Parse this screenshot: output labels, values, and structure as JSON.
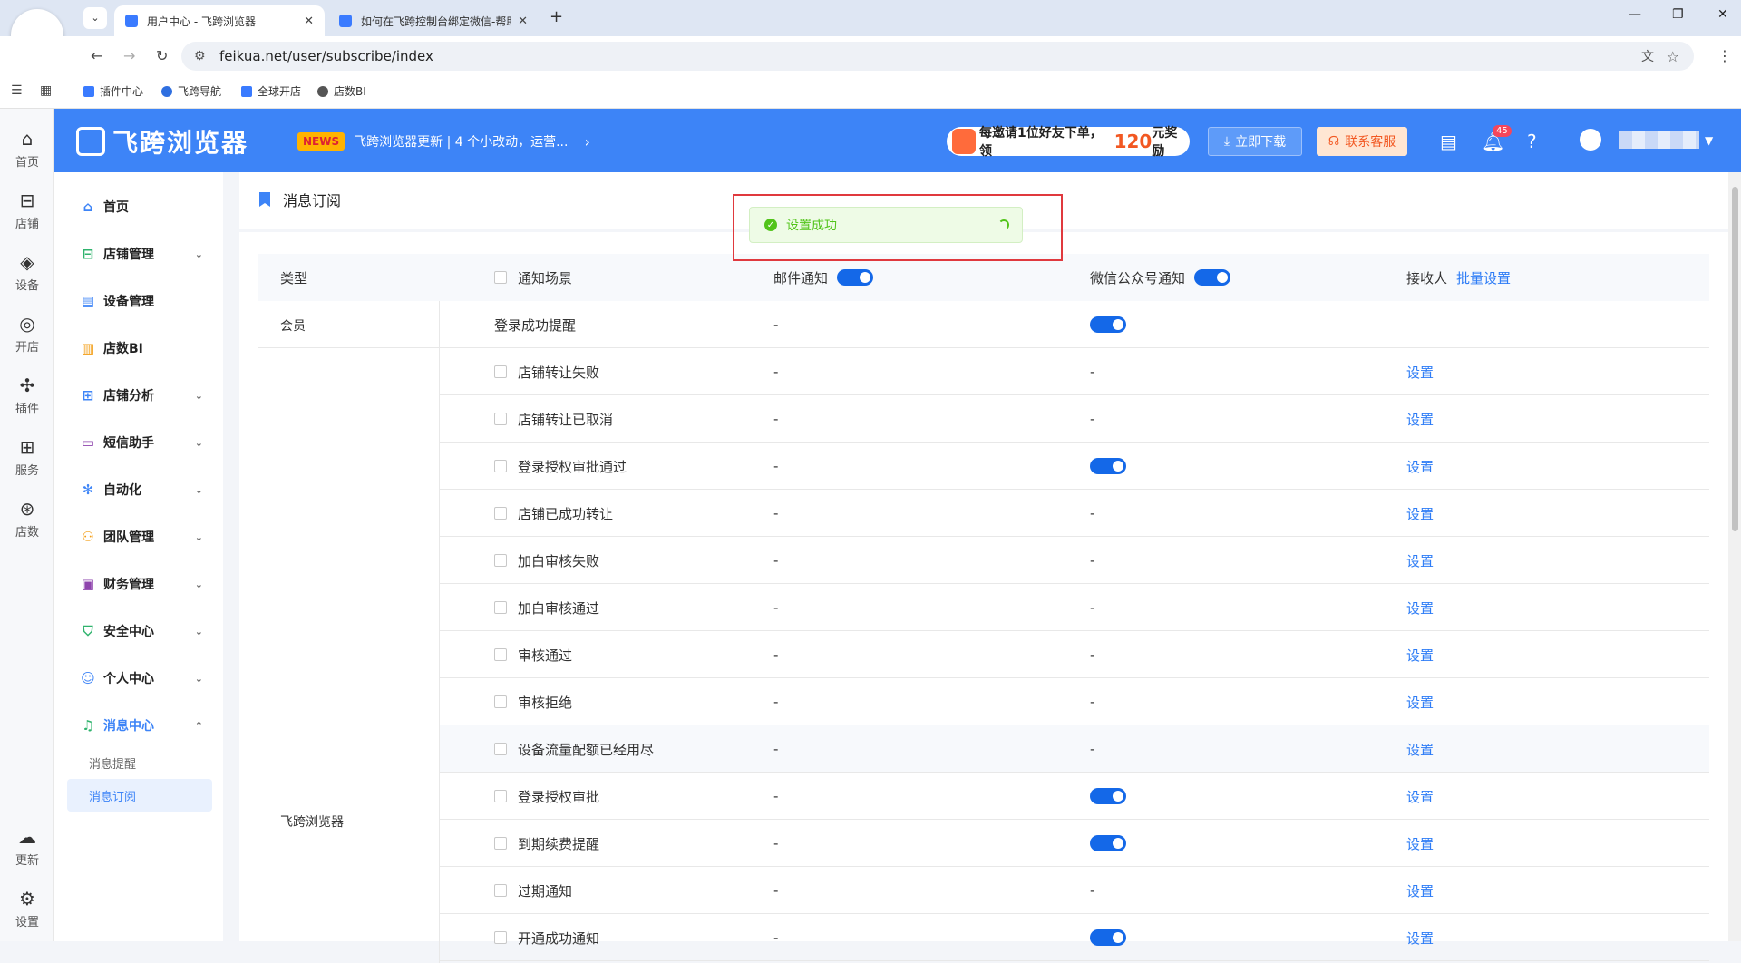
{
  "browser": {
    "tabs": [
      {
        "title": "用户中心 - 飞跨浏览器"
      },
      {
        "title": "如何在飞跨控制台绑定微信-帮助"
      }
    ],
    "url": "feikua.net/user/subscribe/index",
    "bookmarks": [
      "插件中心",
      "飞跨导航",
      "全球开店",
      "店数BI"
    ]
  },
  "rail": {
    "items": [
      "首页",
      "店铺",
      "设备",
      "开店",
      "插件",
      "服务",
      "店数"
    ],
    "bottom": [
      "更新",
      "设置"
    ]
  },
  "header": {
    "brand": "飞跨浏览器",
    "news_badge": "NEWS",
    "news_text": "飞跨浏览器更新 | 4 个小改动，运营...",
    "invite_pre": "每邀请1位好友下单，领",
    "invite_amount": "120",
    "invite_post": "元奖励",
    "download": "立即下载",
    "support": "联系客服",
    "notif_count": "45"
  },
  "sidenav": {
    "items": [
      "首页",
      "店铺管理",
      "设备管理",
      "店数BI",
      "店铺分析",
      "短信助手",
      "自动化",
      "团队管理",
      "财务管理",
      "安全中心",
      "个人中心",
      "消息中心"
    ],
    "sub": [
      "消息提醒",
      "消息订阅"
    ]
  },
  "page": {
    "title": "消息订阅"
  },
  "toast": {
    "text": "设置成功"
  },
  "table": {
    "headers": {
      "type": "类型",
      "scene": "通知场景",
      "email": "邮件通知",
      "wechat": "微信公众号通知",
      "receiver": "接收人",
      "batch": "批量设置"
    },
    "groups": [
      "会员",
      "飞跨浏览器"
    ],
    "rows": [
      {
        "scene": "登录成功提醒",
        "email": "-",
        "wechat_on": true,
        "wechat": "",
        "action": "",
        "checkbox": false
      },
      {
        "scene": "店铺转让失败",
        "email": "-",
        "wechat_on": false,
        "wechat": "-",
        "action": "设置",
        "checkbox": true
      },
      {
        "scene": "店铺转让已取消",
        "email": "-",
        "wechat_on": false,
        "wechat": "-",
        "action": "设置",
        "checkbox": true
      },
      {
        "scene": "登录授权审批通过",
        "email": "-",
        "wechat_on": true,
        "wechat": "",
        "action": "设置",
        "checkbox": true
      },
      {
        "scene": "店铺已成功转让",
        "email": "-",
        "wechat_on": false,
        "wechat": "-",
        "action": "设置",
        "checkbox": true
      },
      {
        "scene": "加白审核失败",
        "email": "-",
        "wechat_on": false,
        "wechat": "-",
        "action": "设置",
        "checkbox": true
      },
      {
        "scene": "加白审核通过",
        "email": "-",
        "wechat_on": false,
        "wechat": "-",
        "action": "设置",
        "checkbox": true
      },
      {
        "scene": "审核通过",
        "email": "-",
        "wechat_on": false,
        "wechat": "-",
        "action": "设置",
        "checkbox": true
      },
      {
        "scene": "审核拒绝",
        "email": "-",
        "wechat_on": false,
        "wechat": "-",
        "action": "设置",
        "checkbox": true
      },
      {
        "scene": "设备流量配额已经用尽",
        "email": "-",
        "wechat_on": false,
        "wechat": "-",
        "action": "设置",
        "checkbox": true
      },
      {
        "scene": "登录授权审批",
        "email": "-",
        "wechat_on": true,
        "wechat": "",
        "action": "设置",
        "checkbox": true
      },
      {
        "scene": "到期续费提醒",
        "email": "-",
        "wechat_on": true,
        "wechat": "",
        "action": "设置",
        "checkbox": true
      },
      {
        "scene": "过期通知",
        "email": "-",
        "wechat_on": false,
        "wechat": "-",
        "action": "设置",
        "checkbox": true
      },
      {
        "scene": "开通成功通知",
        "email": "-",
        "wechat_on": true,
        "wechat": "",
        "action": "设置",
        "checkbox": true
      }
    ]
  }
}
